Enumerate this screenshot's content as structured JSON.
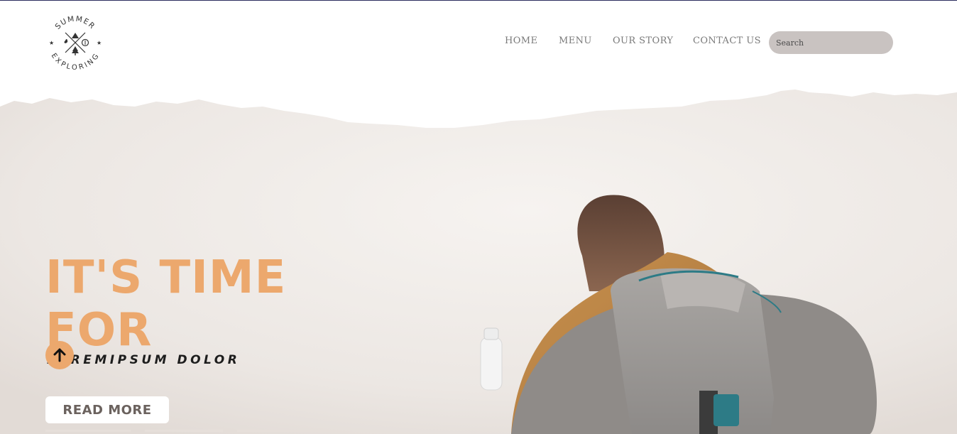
{
  "logo": {
    "top_text": "SUMMER",
    "bottom_text": "EXPLORING",
    "icon": "tent-compass-tree-emblem"
  },
  "nav": {
    "items": [
      {
        "label": "HOME"
      },
      {
        "label": "MENU"
      },
      {
        "label": "OUR STORY"
      },
      {
        "label": "CONTACT US"
      }
    ],
    "search": {
      "placeholder": "Search",
      "value": ""
    }
  },
  "hero": {
    "headline_line1": "IT'S TIME",
    "headline_line2": "FOR",
    "subtitle": "LOREMIPSUM DOLOR",
    "read_more_label": "READ MORE",
    "scroll_top_icon": "arrow-up-icon"
  },
  "colors": {
    "accent": "#eca86d",
    "search_bg": "#c9c3c1",
    "nav_text": "#7a7a7a",
    "button_text": "#6b625e",
    "top_border": "#2b2d5e"
  }
}
